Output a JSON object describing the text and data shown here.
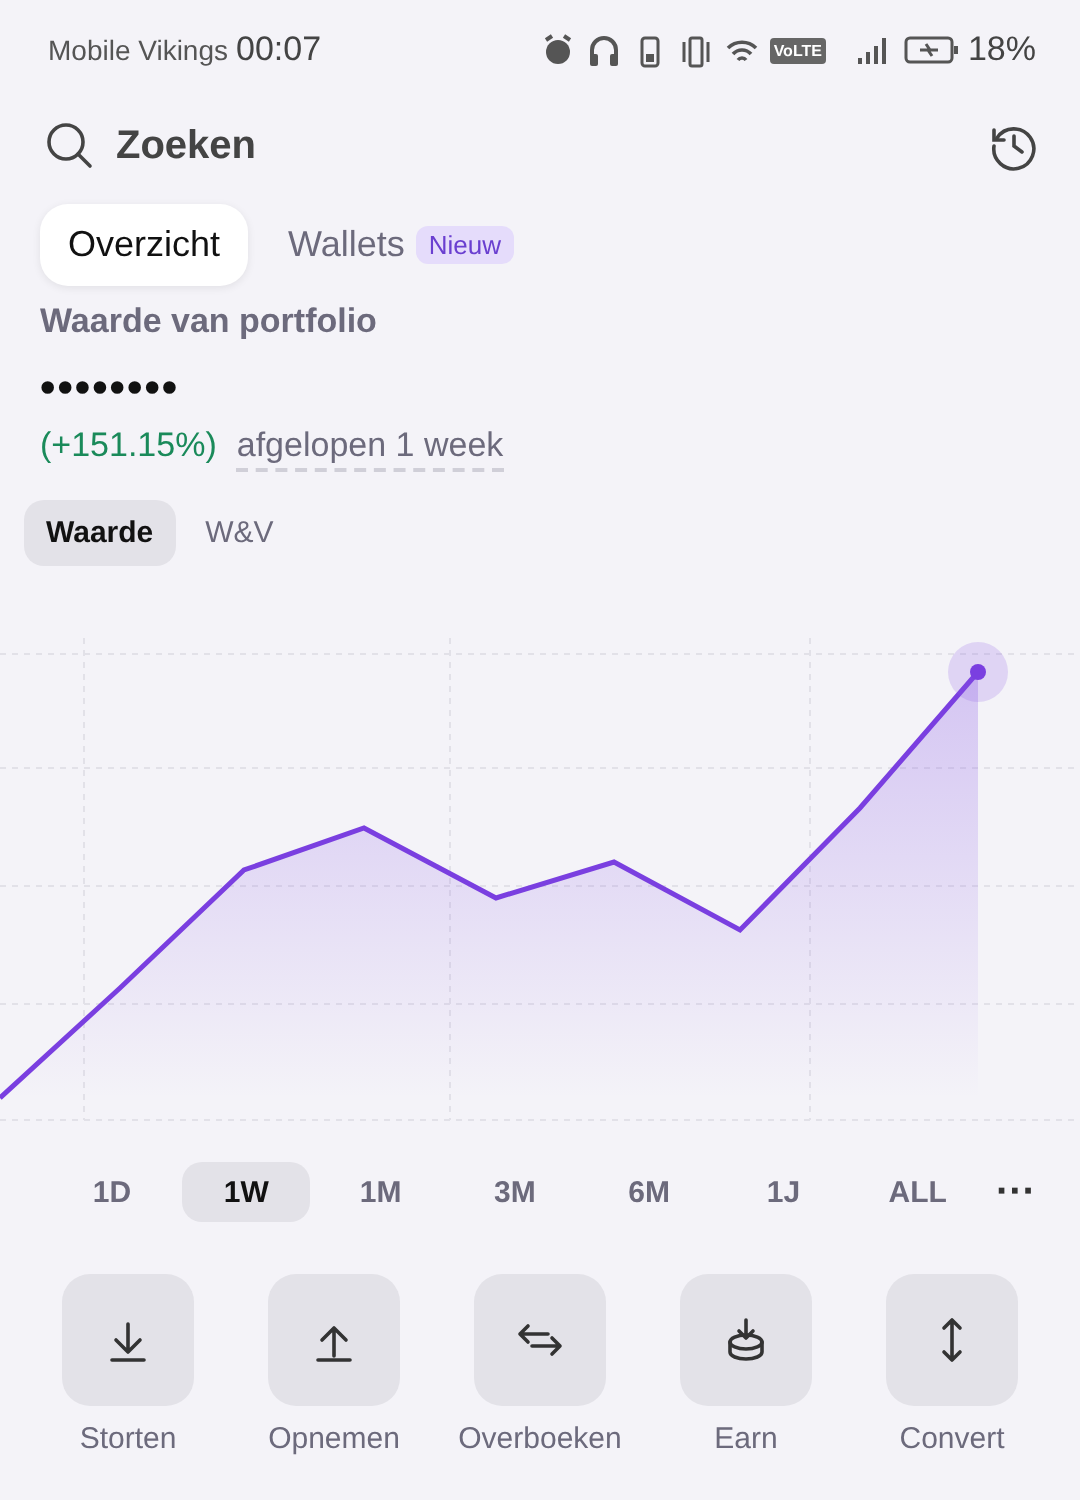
{
  "status_bar": {
    "carrier": "Mobile Vikings",
    "time": "00:07",
    "network_badge": "VoLTE",
    "battery": "18%"
  },
  "search": {
    "placeholder": "Zoeken"
  },
  "tabs": [
    {
      "label": "Overzicht",
      "selected": true
    },
    {
      "label": "Wallets",
      "selected": false,
      "badge": "Nieuw"
    }
  ],
  "portfolio": {
    "title": "Waarde van portfolio",
    "value": "••••••••",
    "change": "(+151.15%)",
    "period": "afgelopen 1 week"
  },
  "chart_modes": [
    {
      "label": "Waarde",
      "selected": true
    },
    {
      "label": "W&V",
      "selected": false
    }
  ],
  "periods": [
    {
      "label": "1D",
      "selected": false
    },
    {
      "label": "1W",
      "selected": true
    },
    {
      "label": "1M",
      "selected": false
    },
    {
      "label": "3M",
      "selected": false
    },
    {
      "label": "6M",
      "selected": false
    },
    {
      "label": "1J",
      "selected": false
    },
    {
      "label": "ALL",
      "selected": false
    }
  ],
  "more": "···",
  "actions": [
    {
      "label": "Storten",
      "kind": "deposit"
    },
    {
      "label": "Opnemen",
      "kind": "withdraw"
    },
    {
      "label": "Overboeken",
      "kind": "transfer"
    },
    {
      "label": "Earn",
      "kind": "earn"
    },
    {
      "label": "Convert",
      "kind": "convert"
    }
  ]
}
